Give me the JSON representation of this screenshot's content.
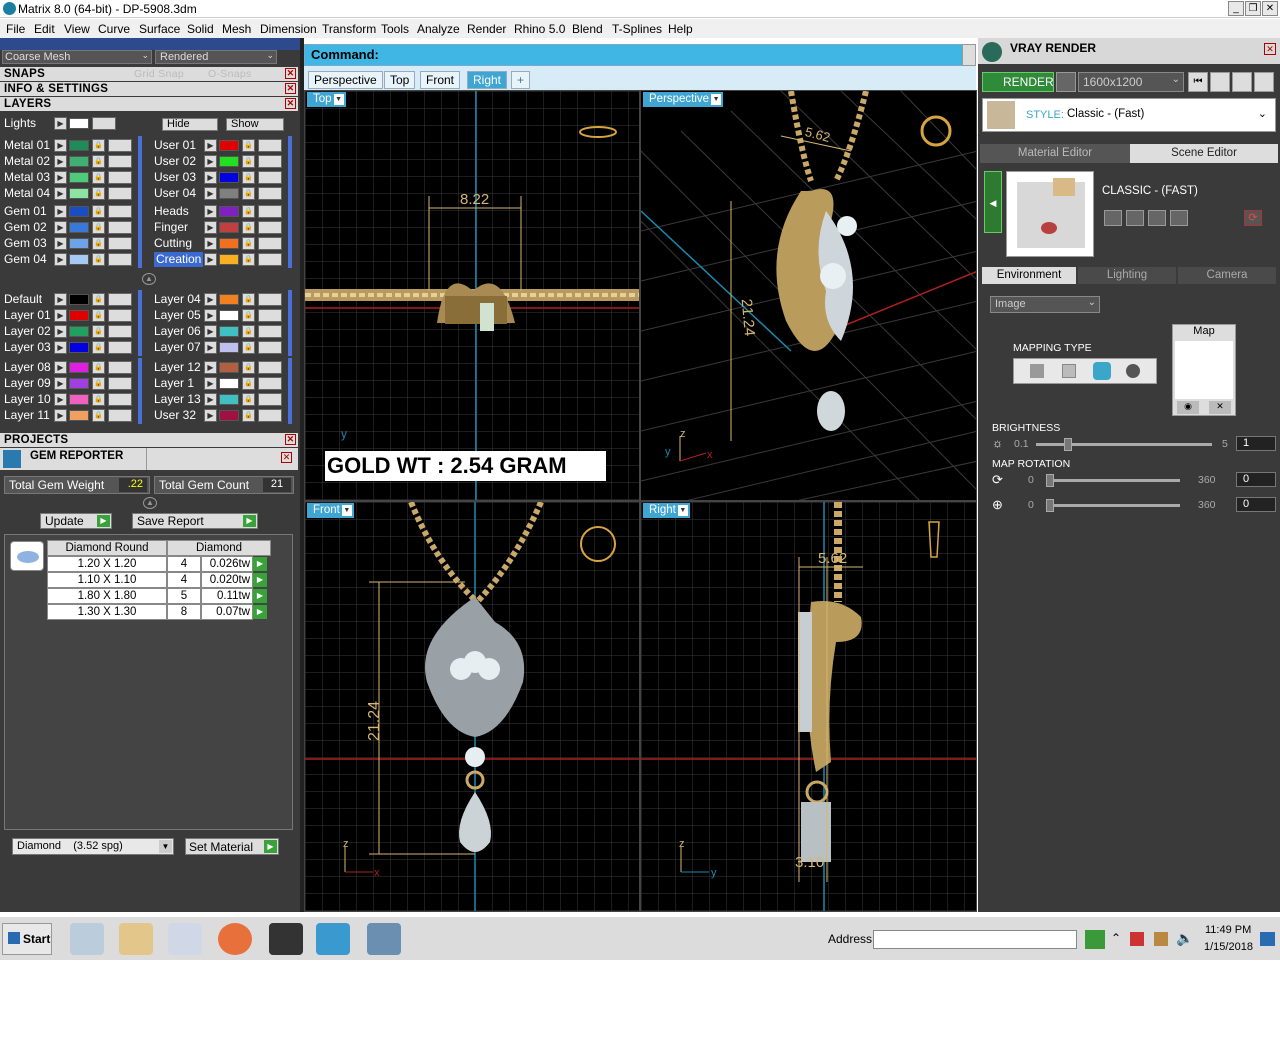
{
  "window": {
    "title": "Matrix 8.0 (64-bit) - DP-5908.3dm"
  },
  "menu": [
    "File",
    "Edit",
    "View",
    "Curve",
    "Surface",
    "Solid",
    "Mesh",
    "Dimension",
    "Transform",
    "Tools",
    "Analyze",
    "Render",
    "Rhino 5.0",
    "Blend",
    "T-Splines",
    "Help"
  ],
  "toolbar": {
    "mesh_select": "Coarse Mesh",
    "display_select": "Rendered"
  },
  "left": {
    "snaps": "SNAPS",
    "snaps_grid": "Grid Snap",
    "snaps_osnap": "O-Snaps",
    "info": "INFO & SETTINGS",
    "layers": "LAYERS",
    "lights": "Lights",
    "hide": "Hide",
    "show": "Show",
    "layer_col1_a": [
      "Metal 01",
      "Metal 02",
      "Metal 03",
      "Metal 04"
    ],
    "layer_col2_a": [
      "User 01",
      "User 02",
      "User 03",
      "User 04"
    ],
    "layer_col1_b": [
      "Gem 01",
      "Gem 02",
      "Gem 03",
      "Gem 04"
    ],
    "layer_col2_b": [
      "Heads",
      "Finger",
      "Cutting",
      "Creation"
    ],
    "layer_col1_c": [
      "Default",
      "Layer 01",
      "Layer 02",
      "Layer 03"
    ],
    "layer_col2_c": [
      "Layer 04",
      "Layer 05",
      "Layer 06",
      "Layer 07"
    ],
    "layer_col1_d": [
      "Layer 08",
      "Layer 09",
      "Layer 10",
      "Layer 11"
    ],
    "layer_col2_d": [
      "Layer 12",
      "Layer 1",
      "Layer 13",
      "User 32"
    ],
    "projects": "PROJECTS",
    "gem_reporter": "GEM REPORTER",
    "total_gem_weight_label": "Total Gem Weight",
    "total_gem_weight": ".22",
    "total_gem_count_label": "Total Gem Count",
    "total_gem_count": "21",
    "update": "Update",
    "save_report": "Save Report",
    "table_headers": [
      "Diamond Round",
      "Diamond"
    ],
    "table_rows": [
      {
        "size": "1.20 X 1.20",
        "count": "4",
        "wt": "0.026tw"
      },
      {
        "size": "1.10 X 1.10",
        "count": "4",
        "wt": "0.020tw"
      },
      {
        "size": "1.80 X 1.80",
        "count": "5",
        "wt": "0.11tw"
      },
      {
        "size": "1.30 X 1.30",
        "count": "8",
        "wt": "0.07tw"
      }
    ],
    "material_select": "Diamond    (3.52 spg)",
    "set_material": "Set Material"
  },
  "command": {
    "label": "Command:"
  },
  "tabs": [
    "Perspective",
    "Top",
    "Front",
    "Right",
    "+"
  ],
  "viewports": {
    "top": {
      "label": "Top",
      "dim": "8.22",
      "gold": "GOLD WT : 2.54 GRAM",
      "axis_y": "y"
    },
    "perspective": {
      "label": "Perspective",
      "dim1": "5.62",
      "dim2": "21.24",
      "axis_z": "z",
      "axis_y": "y",
      "axis_x": "x"
    },
    "front": {
      "label": "Front",
      "dim": "21.24",
      "axis_z": "z",
      "axis_x": "x"
    },
    "right": {
      "label": "Right",
      "dim1": "5.62",
      "dim2": "3.10",
      "axis_z": "z",
      "axis_y": "y"
    }
  },
  "right": {
    "title": "VRAY RENDER",
    "render": "RENDER",
    "resolution": "1600x1200",
    "style_label": "STYLE:",
    "style_value": "Classic - (Fast)",
    "tab_material": "Material Editor",
    "tab_scene": "Scene Editor",
    "preset_name": "CLASSIC - (FAST)",
    "env_tabs": [
      "Environment",
      "Lighting",
      "Camera"
    ],
    "env_select": "Image",
    "map_label": "Map",
    "mapping_type": "MAPPING TYPE",
    "brightness": "BRIGHTNESS",
    "bright_min": "0.1",
    "bright_max": "5",
    "bright_val": "1",
    "map_rotation": "MAP ROTATION",
    "rot_min": "0",
    "rot_max": "360",
    "rot_val": "0",
    "rot2_min": "0",
    "rot2_max": "360",
    "rot2_val": "0"
  },
  "taskbar": {
    "start": "Start",
    "address": "Address",
    "time": "11:49 PM",
    "date": "1/15/2018"
  }
}
